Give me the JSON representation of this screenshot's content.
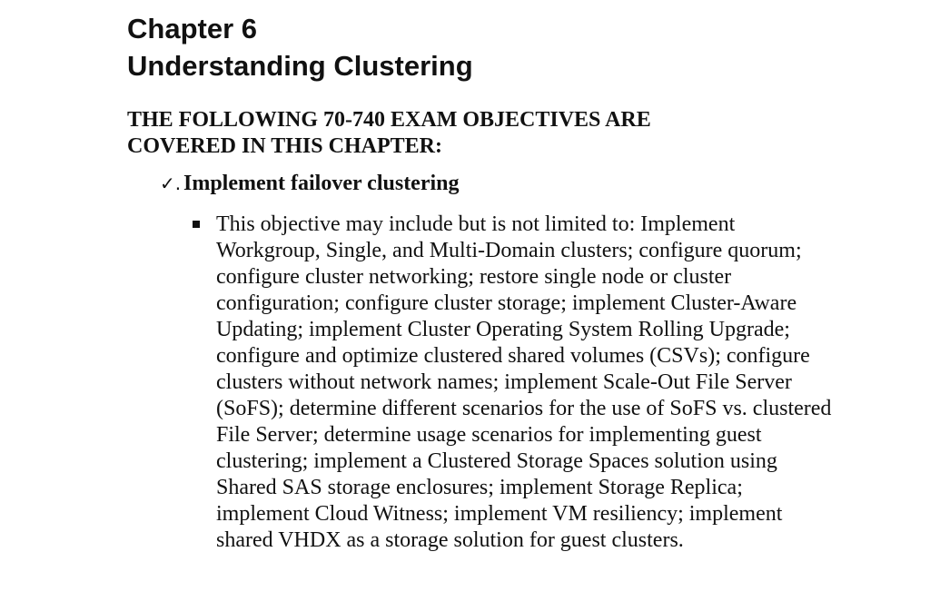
{
  "chapter": {
    "number_label": "Chapter 6",
    "title": "Understanding Clustering"
  },
  "objectives_heading": "THE FOLLOWING 70-740 EXAM OBJECTIVES ARE COVERED IN THIS CHAPTER:",
  "objective": {
    "icon": "check-icon",
    "marker": "✓.",
    "title": "Implement failover clustering",
    "details": [
      {
        "icon": "square-bullet-icon",
        "text": "This objective may include but is not limited to: Implement Workgroup, Single, and Multi-Domain clusters; configure quorum; configure cluster networking; restore single node or cluster configuration; configure cluster storage; implement Cluster-Aware Updating; implement Cluster Operating System Rolling Upgrade; configure and optimize clustered shared volumes (CSVs); configure clusters without network names; implement Scale-Out File Server (SoFS); determine different scenarios for the use of SoFS vs. clustered File Server; determine usage scenarios for implementing guest clustering; implement a Clustered Storage Spaces solution using Shared SAS storage enclosures; implement Storage Replica; implement Cloud Witness; implement VM resiliency; implement shared VHDX as a storage solution for guest clusters."
      }
    ]
  }
}
